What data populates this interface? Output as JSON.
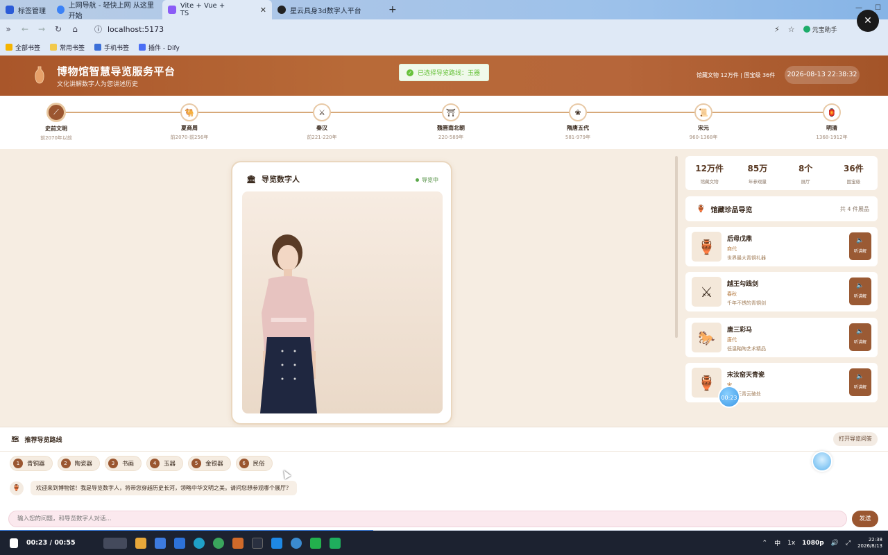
{
  "browser": {
    "tabs": [
      {
        "label": "标签管理",
        "color": "#2b5bd7"
      },
      {
        "label": "上网导航 - 轻快上网 从这里开始",
        "color": "#3b82f6"
      },
      {
        "label": "Vite + Vue + TS",
        "color": "#8b5cf6"
      },
      {
        "label": "星云具身3d数字人平台",
        "color": "#222222"
      }
    ],
    "url": "localhost:5173",
    "assistant": "元宝助手",
    "bookmarks": [
      "全部书签",
      "常用书签",
      "手机书签",
      "插件 - Dify"
    ]
  },
  "header": {
    "title": "博物馆智慧导览服务平台",
    "subtitle": "文化讲解数字人为您讲述历史",
    "toast": "已选择导览路线：玉器",
    "stats": "馆藏文物 12万件  |  国宝级 36件",
    "datetime": "2026-08-13 22:38:32"
  },
  "timeline": [
    {
      "name": "史前文明",
      "range": "前2070年以前",
      "icon": "bone",
      "active": true
    },
    {
      "name": "夏商周",
      "range": "前2070-前256年",
      "icon": "camel"
    },
    {
      "name": "秦汉",
      "range": "前221-220年",
      "icon": "swords"
    },
    {
      "name": "魏晋南北朝",
      "range": "220-589年",
      "icon": "temple"
    },
    {
      "name": "隋唐五代",
      "range": "581-979年",
      "icon": "flower"
    },
    {
      "name": "宋元",
      "range": "960-1368年",
      "icon": "scroll"
    },
    {
      "name": "明清",
      "range": "1368-1912年",
      "icon": "lantern"
    }
  ],
  "avatar_card": {
    "title": "导览数字人",
    "status": "导览中"
  },
  "stats": [
    {
      "value": "12万件",
      "label": "馆藏文物"
    },
    {
      "value": "85万",
      "label": "年参观量"
    },
    {
      "value": "8个",
      "label": "展厅"
    },
    {
      "value": "36件",
      "label": "国宝级"
    }
  ],
  "treasures": {
    "title": "馆藏珍品导览",
    "count": "共 4 件展品",
    "items": [
      {
        "name": "后母戊鼎",
        "era": "商代",
        "desc": "世界最大青铜礼器",
        "icon": "🏺"
      },
      {
        "name": "越王勾践剑",
        "era": "春秋",
        "desc": "千年不锈的青铜剑",
        "icon": "⚔"
      },
      {
        "name": "唐三彩马",
        "era": "唐代",
        "desc": "低温釉陶艺术精品",
        "icon": "🐎"
      },
      {
        "name": "宋汝窑天青瓷",
        "era": "宋",
        "desc": "雨过天青云破处",
        "icon": "🏺"
      }
    ],
    "listen_label": "听讲解"
  },
  "timer_bubble": "00:23",
  "routes": {
    "title": "推荐导览路线",
    "open_qa": "打开导览问答",
    "chips": [
      {
        "num": "1",
        "label": "青铜器"
      },
      {
        "num": "2",
        "label": "陶瓷器"
      },
      {
        "num": "3",
        "label": "书画"
      },
      {
        "num": "4",
        "label": "玉器"
      },
      {
        "num": "5",
        "label": "金银器"
      },
      {
        "num": "6",
        "label": "民俗"
      }
    ]
  },
  "chat": {
    "welcome": "欢迎来到博物馆！我是导览数字人，将带您穿越历史长河，领略中华文明之美。请问您想参观哪个展厅？",
    "placeholder": "输入您的问题，和导览数字人对话...",
    "send": "发送"
  },
  "player": {
    "time": "00:23 / 00:55",
    "progress": 0.42,
    "quality": "1080p",
    "speed": "1x",
    "ime": "中"
  },
  "taskbar_clock": {
    "time": "22:38",
    "date": "2026/8/13"
  }
}
